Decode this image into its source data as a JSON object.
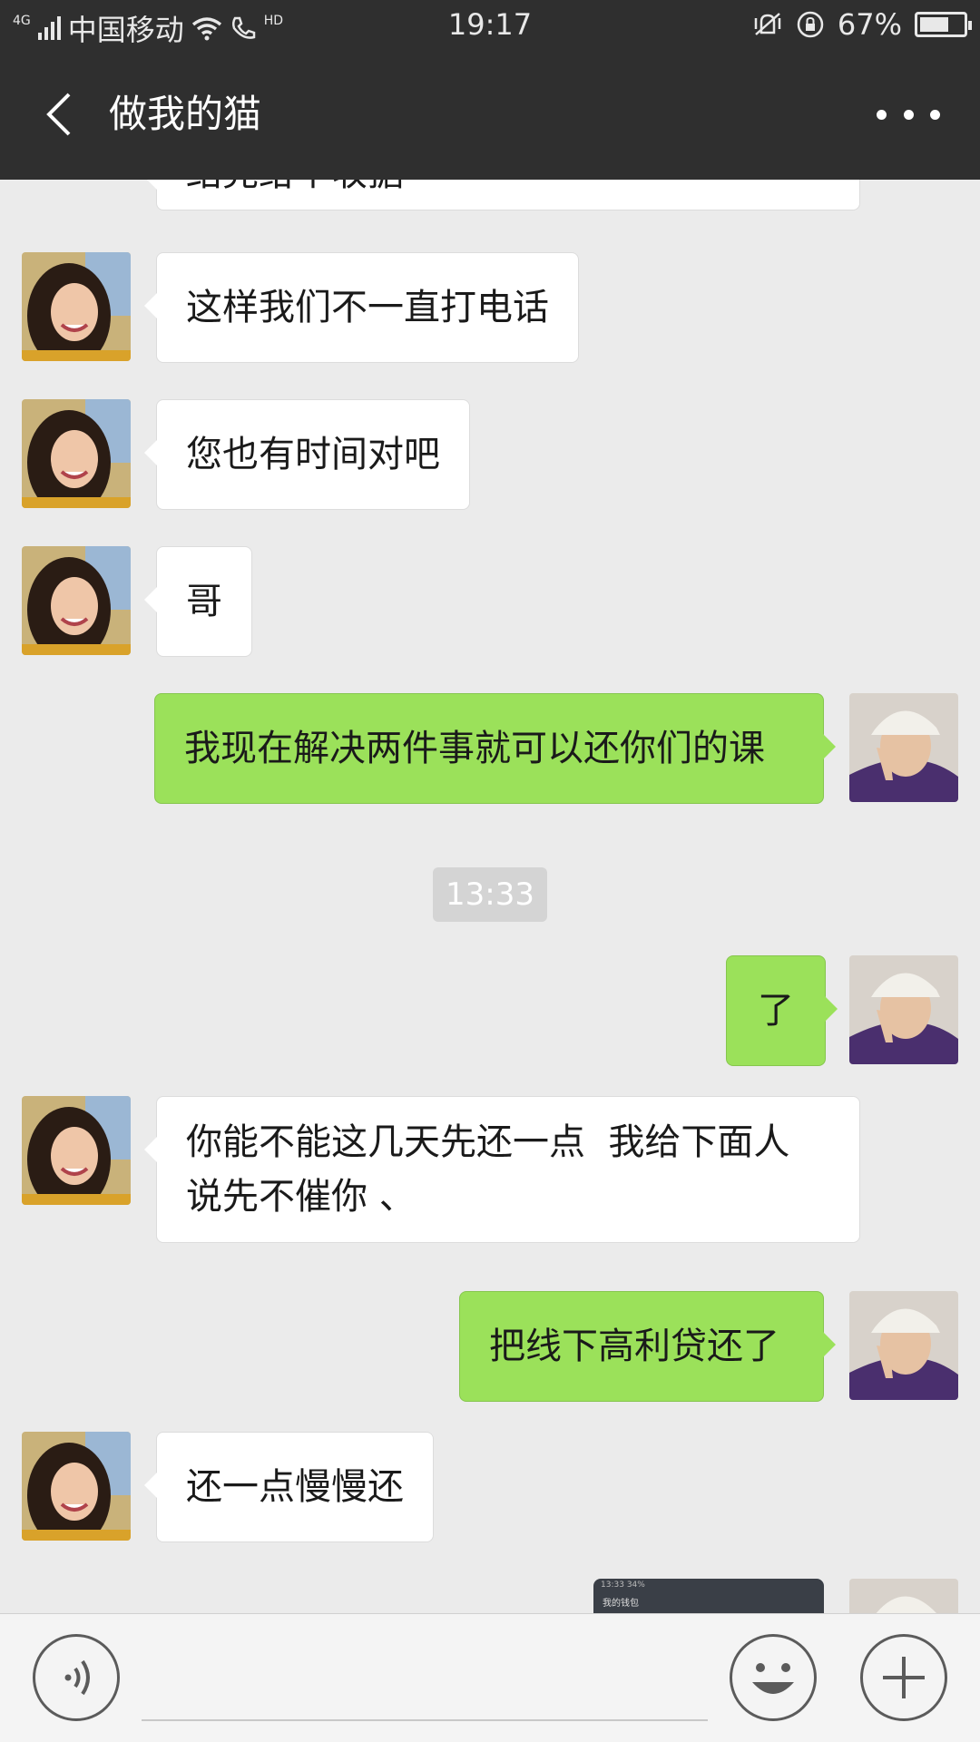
{
  "status_bar": {
    "network": "4G",
    "carrier": "中国移动",
    "hd": "HD",
    "time": "19:17",
    "battery": "67%",
    "battery_level": 0.67
  },
  "header": {
    "title": "做我的猫",
    "back_icon": "chevron-left-icon",
    "more_icon": "more-dots-icon"
  },
  "messages": [
    {
      "side": "in",
      "text": "结完给个收据"
    },
    {
      "side": "in",
      "text": "这样我们不一直打电话"
    },
    {
      "side": "in",
      "text": "您也有时间对吧"
    },
    {
      "side": "in",
      "text": "哥"
    },
    {
      "side": "out",
      "text": "我现在解决两件事就可以还你们的课"
    },
    {
      "side": "out",
      "text": "了"
    },
    {
      "side": "in",
      "text": "你能不能这几天先还一点  我给下面人说先不催你 、"
    },
    {
      "side": "out",
      "text": "把线下高利贷还了"
    },
    {
      "side": "in",
      "text": "还一点慢慢还"
    }
  ],
  "timestamp": "13:33",
  "image_preview": {
    "status_time": "13:33",
    "status_battery": "34%",
    "title": "我的钱包"
  },
  "input_bar": {
    "voice_icon": "voice-icon",
    "emoji_icon": "emoji-icon",
    "plus_icon": "plus-icon"
  },
  "colors": {
    "header_bg": "#2f2f2f",
    "chat_bg": "#ebebeb",
    "outgoing_bubble": "#9be15a",
    "incoming_bubble": "#ffffff"
  }
}
